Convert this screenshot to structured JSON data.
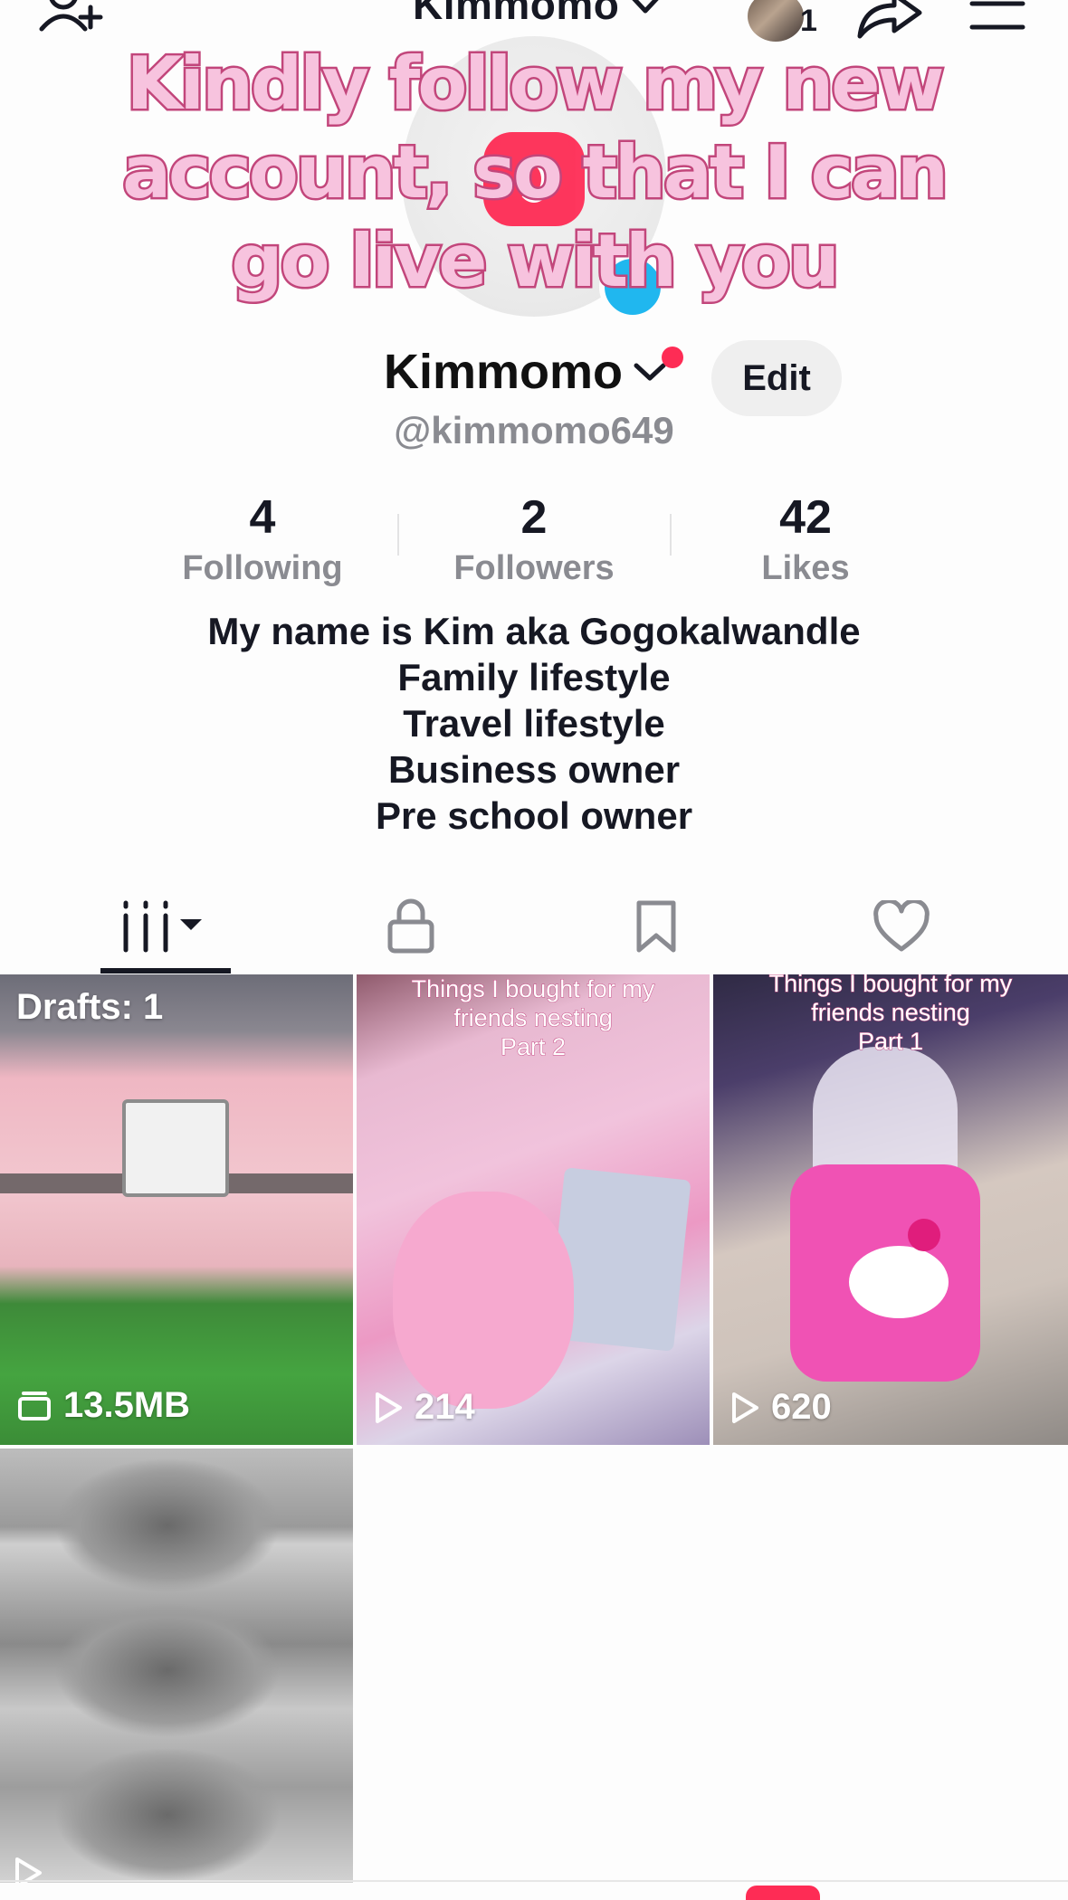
{
  "header": {
    "username": "Kimmomo",
    "avatar_badge_count": "1"
  },
  "overlay_text": "Kindly follow my new account, so that I can go live with you",
  "profile": {
    "name": "Kimmomo",
    "handle": "@kimmomo649",
    "edit_label": "Edit",
    "stats": [
      {
        "value": "4",
        "label": "Following"
      },
      {
        "value": "2",
        "label": "Followers"
      },
      {
        "value": "42",
        "label": "Likes"
      }
    ],
    "bio": [
      "My name is Kim aka Gogokalwandle",
      "Family lifestyle",
      "Travel lifestyle",
      "Business owner",
      "Pre school owner"
    ]
  },
  "tabs": [
    {
      "icon": "videos-grid-icon",
      "active": true
    },
    {
      "icon": "lock-icon"
    },
    {
      "icon": "bookmark-icon"
    },
    {
      "icon": "heart-icon"
    }
  ],
  "videos": [
    {
      "top_label": "Drafts: 1",
      "stat": "13.5MB",
      "stat_icon": "drafts-icon"
    },
    {
      "caption": [
        "Things I bought for my",
        "friends nesting",
        "Part 2"
      ],
      "stat": "214",
      "stat_icon": "play-icon"
    },
    {
      "caption": [
        "Things I bought for my",
        "friends nesting",
        "Part 1"
      ],
      "stat": "620",
      "stat_icon": "play-icon"
    },
    {
      "stat": "",
      "stat_icon": "play-icon"
    }
  ],
  "colors": {
    "accent_red": "#fe2c55",
    "badge_blue": "#20b7ef",
    "overlay_fill": "#f7c3de",
    "overlay_stroke": "#c2467b"
  }
}
